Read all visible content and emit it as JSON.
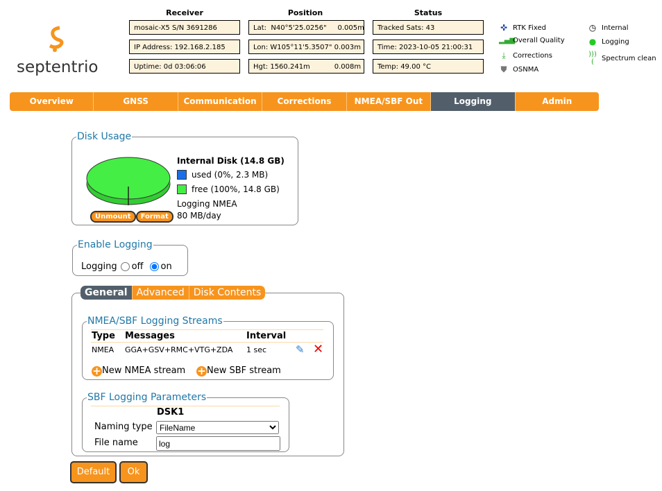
{
  "logo": "septentrio",
  "receiver": {
    "header": "Receiver",
    "model": "mosaic-X5 S/N 3691286",
    "ip": "IP Address: 192.168.2.185",
    "uptime": "Uptime: 0d 03:06:06"
  },
  "position": {
    "header": "Position",
    "lat": "Lat:  N40°5'25.0256\"     0.005m",
    "lon": "Lon: W105°11'5.3507\" 0.003m",
    "hgt": "Hgt: 1560.241m           0.008m"
  },
  "status": {
    "header": "Status",
    "sats": "Tracked Sats: 43",
    "time": "Time: 2023-10-05 21:00:31",
    "temp": "Temp: 49.00 °C"
  },
  "indicators": [
    "RTK Fixed",
    "Overall Quality",
    "Corrections",
    "OSNMA",
    "Internal",
    "Logging",
    "Spectrum clean"
  ],
  "nav": [
    "Overview",
    "GNSS",
    "Communication",
    "Corrections",
    "NMEA/SBF Out",
    "Logging",
    "Admin"
  ],
  "disk": {
    "legend": "Disk Usage",
    "title": "Internal Disk (14.8 GB)",
    "used": "used (0%, 2.3 MB)",
    "free": "free (100%, 14.8 GB)",
    "logging": "Logging NMEA",
    "rate": "80 MB/day",
    "unmount": "Unmount",
    "format": "Format",
    "used_pct": 0,
    "used_color": "#1a6fe8",
    "free_color": "#44ee44"
  },
  "enable": {
    "legend": "Enable Logging",
    "label": "Logging",
    "off": "off",
    "on": "on",
    "selected": "on"
  },
  "tabs": [
    "General",
    "Advanced",
    "Disk Contents"
  ],
  "streams": {
    "legend": "NMEA/SBF Logging Streams",
    "headers": [
      "Type",
      "Messages",
      "Interval"
    ],
    "rows": [
      {
        "type": "NMEA",
        "messages": "GGA+GSV+RMC+VTG+ZDA",
        "interval": "1 sec"
      }
    ],
    "new_nmea": "New NMEA stream",
    "new_sbf": "New SBF stream"
  },
  "params": {
    "legend": "SBF Logging Parameters",
    "column": "DSK1",
    "naming_label": "Naming type",
    "naming_value": "FileName",
    "file_label": "File name",
    "file_value": "log"
  },
  "buttons": {
    "default": "Default",
    "ok": "Ok"
  }
}
